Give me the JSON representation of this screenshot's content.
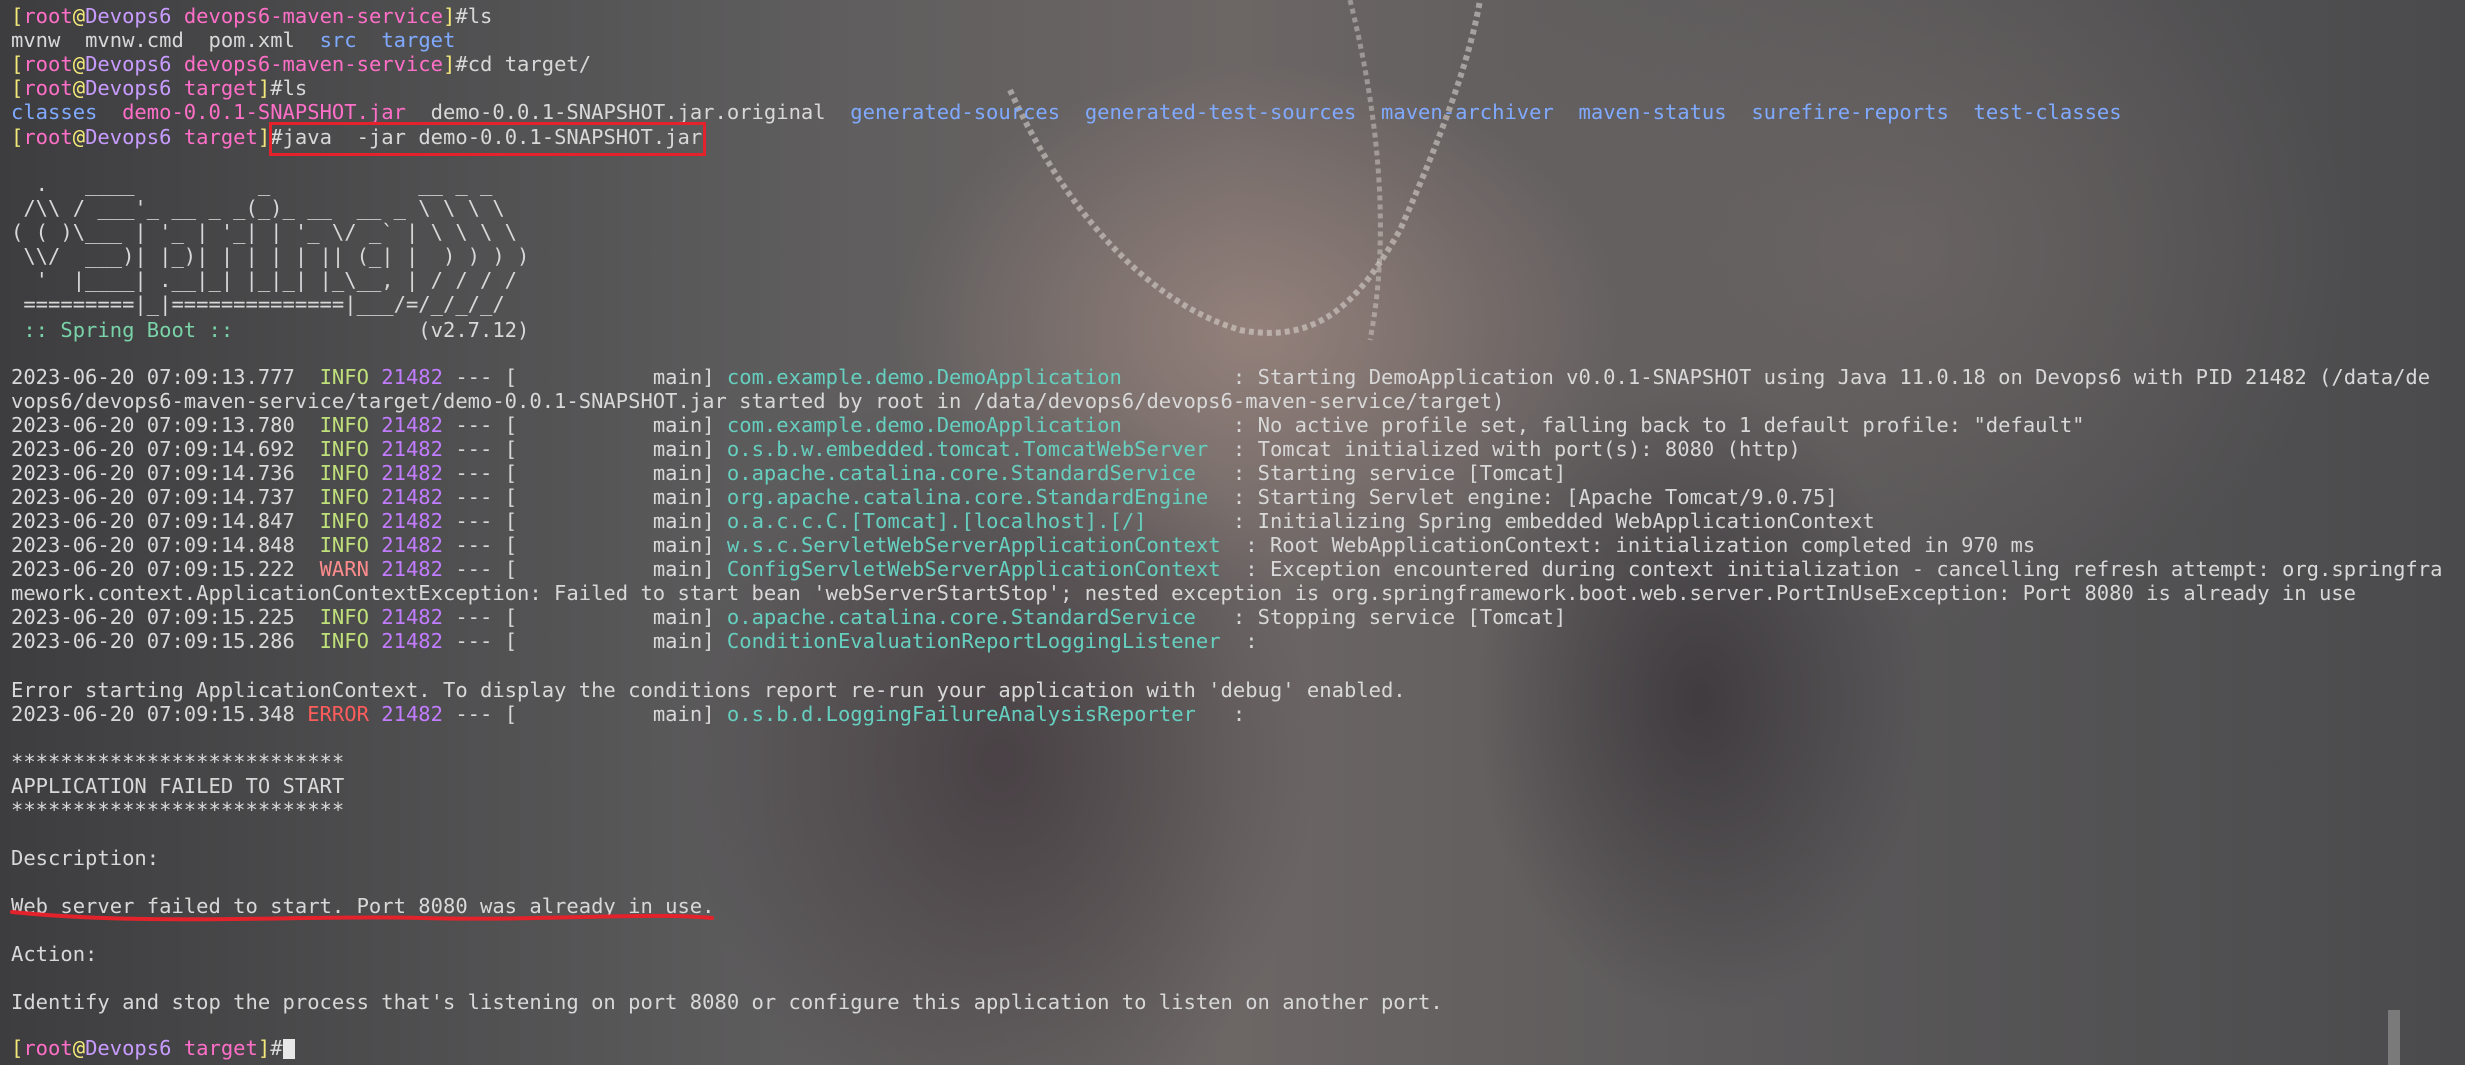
{
  "prompt": {
    "user": "root",
    "host": "Devops6",
    "dir_service": "devops6-maven-service",
    "dir_target": "target"
  },
  "lines": {
    "l1_cmd": "ls",
    "l2_files": [
      "mvnw",
      "mvnw.cmd",
      "pom.xml",
      "src",
      "target"
    ],
    "l3_cmd": "cd target/",
    "l4_cmd": "ls",
    "l5_files": [
      "classes",
      "demo-0.0.1-SNAPSHOT.jar",
      "demo-0.0.1-SNAPSHOT.jar.original",
      "generated-sources",
      "generated-test-sources",
      "maven-archiver",
      "maven-status",
      "surefire-reports",
      "test-classes"
    ],
    "l6_cmd": "java  -jar demo-0.0.1-SNAPSHOT.jar"
  },
  "banner": {
    "art": [
      "  .   ____          _            __ _ _",
      " /\\\\ / ___'_ __ _ _(_)_ __  __ _ \\ \\ \\ \\",
      "( ( )\\___ | '_ | '_| | '_ \\/ _` | \\ \\ \\ \\",
      " \\\\/  ___)| |_)| | | | | || (_| |  ) ) ) )",
      "  '  |____| .__|_| |_|_| |_\\__, | / / / /",
      " =========|_|==============|___/=/_/_/_/"
    ],
    "spring_label": " :: Spring Boot :: ",
    "version": "              (v2.7.12)"
  },
  "logs": [
    {
      "ts": "2023-06-20 07:09:13.777",
      "level": "INFO",
      "pid": "21482",
      "thread": "main",
      "logger": "com.example.demo.DemoApplication",
      "msg": "Starting DemoApplication v0.0.1-SNAPSHOT using Java 11.0.18 on Devops6 with PID 21482 (/data/de",
      "cont": "vops6/devops6-maven-service/target/demo-0.0.1-SNAPSHOT.jar started by root in /data/devops6/devops6-maven-service/target)"
    },
    {
      "ts": "2023-06-20 07:09:13.780",
      "level": "INFO",
      "pid": "21482",
      "thread": "main",
      "logger": "com.example.demo.DemoApplication",
      "msg": "No active profile set, falling back to 1 default profile: \"default\""
    },
    {
      "ts": "2023-06-20 07:09:14.692",
      "level": "INFO",
      "pid": "21482",
      "thread": "main",
      "logger": "o.s.b.w.embedded.tomcat.TomcatWebServer",
      "msg": "Tomcat initialized with port(s): 8080 (http)"
    },
    {
      "ts": "2023-06-20 07:09:14.736",
      "level": "INFO",
      "pid": "21482",
      "thread": "main",
      "logger": "o.apache.catalina.core.StandardService",
      "msg": "Starting service [Tomcat]"
    },
    {
      "ts": "2023-06-20 07:09:14.737",
      "level": "INFO",
      "pid": "21482",
      "thread": "main",
      "logger": "org.apache.catalina.core.StandardEngine",
      "msg": "Starting Servlet engine: [Apache Tomcat/9.0.75]"
    },
    {
      "ts": "2023-06-20 07:09:14.847",
      "level": "INFO",
      "pid": "21482",
      "thread": "main",
      "logger": "o.a.c.c.C.[Tomcat].[localhost].[/]",
      "msg": "Initializing Spring embedded WebApplicationContext"
    },
    {
      "ts": "2023-06-20 07:09:14.848",
      "level": "INFO",
      "pid": "21482",
      "thread": "main",
      "logger": "w.s.c.ServletWebServerApplicationContext",
      "msg": "Root WebApplicationContext: initialization completed in 970 ms"
    },
    {
      "ts": "2023-06-20 07:09:15.222",
      "level": "WARN",
      "pid": "21482",
      "thread": "main",
      "logger": "ConfigServletWebServerApplicationContext",
      "msg": "Exception encountered during context initialization - cancelling refresh attempt: org.springfra",
      "cont": "mework.context.ApplicationContextException: Failed to start bean 'webServerStartStop'; nested exception is org.springframework.boot.web.server.PortInUseException: Port 8080 is already in use"
    },
    {
      "ts": "2023-06-20 07:09:15.225",
      "level": "INFO",
      "pid": "21482",
      "thread": "main",
      "logger": "o.apache.catalina.core.StandardService",
      "msg": "Stopping service [Tomcat]"
    },
    {
      "ts": "2023-06-20 07:09:15.286",
      "level": "INFO",
      "pid": "21482",
      "thread": "main",
      "logger": "ConditionEvaluationReportLoggingListener",
      "msg": ""
    }
  ],
  "error_context": "Error starting ApplicationContext. To display the conditions report re-run your application with 'debug' enabled.",
  "error_log": {
    "ts": "2023-06-20 07:09:15.348",
    "level": "ERROR",
    "pid": "21482",
    "thread": "main",
    "logger": "o.s.b.d.LoggingFailureAnalysisReporter",
    "msg": ""
  },
  "failure": {
    "stars": "***************************",
    "title": "APPLICATION FAILED TO START",
    "desc_label": "Description:",
    "desc": "Web server failed to start. Port 8080 was already in use.",
    "action_label": "Action:",
    "action": "Identify and stop the process that's listening on port 8080 or configure this application to listen on another port."
  },
  "colors": {
    "highlight_box": "#e3222b",
    "underline": "#e3222b"
  }
}
